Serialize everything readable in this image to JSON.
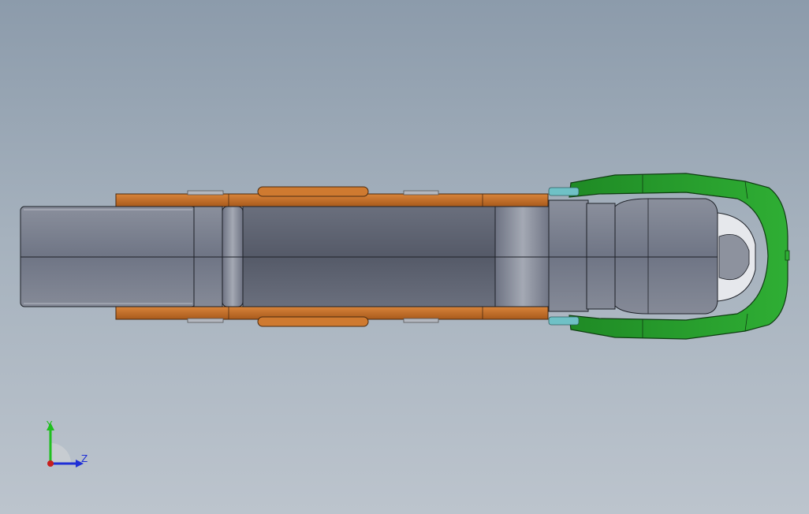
{
  "viewport": {
    "background_top": "#8c9bab",
    "background_bottom": "#bcc4cd"
  },
  "model": {
    "parts": [
      {
        "name": "handle-body",
        "color": "#6f7585"
      },
      {
        "name": "side-plates",
        "color": "#c8732a"
      },
      {
        "name": "clamp-hook",
        "color": "#2f9a2f"
      },
      {
        "name": "pivot-pin",
        "color": "#6fc1c6"
      }
    ],
    "edge_color": "#1e2128"
  },
  "triad": {
    "y_label": "Y",
    "z_label": "Z",
    "y_color": "#1fbf1f",
    "z_color": "#1f2fd6",
    "x_color": "#c81e1e"
  }
}
